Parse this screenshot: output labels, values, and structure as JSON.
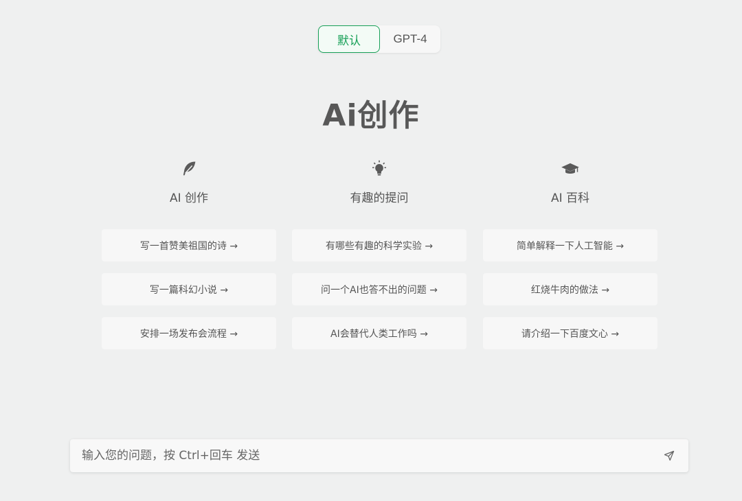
{
  "model_switch": {
    "options": [
      "默认",
      "GPT-4"
    ],
    "selected": "默认"
  },
  "page_title": "Ai创作",
  "columns": [
    {
      "icon": "feather-icon",
      "title": "AI 创作",
      "prompts": [
        "写一首赞美祖国的诗 →",
        "写一篇科幻小说 →",
        "安排一场发布会流程 →"
      ]
    },
    {
      "icon": "lightbulb-icon",
      "title": "有趣的提问",
      "prompts": [
        "有哪些有趣的科学实验 →",
        "问一个AI也答不出的问题 →",
        "AI会替代人类工作吗 →"
      ]
    },
    {
      "icon": "graduation-cap-icon",
      "title": "AI 百科",
      "prompts": [
        "简单解释一下人工智能 →",
        "红烧牛肉的做法 →",
        "请介绍一下百度文心 →"
      ]
    }
  ],
  "input": {
    "placeholder": "输入您的问题，按 Ctrl+回车 发送",
    "value": "",
    "send_icon": "send-icon"
  },
  "colors": {
    "background": "#eff0f0",
    "accent": "#18a058",
    "card": "#f7f7f7",
    "text": "#555555"
  }
}
